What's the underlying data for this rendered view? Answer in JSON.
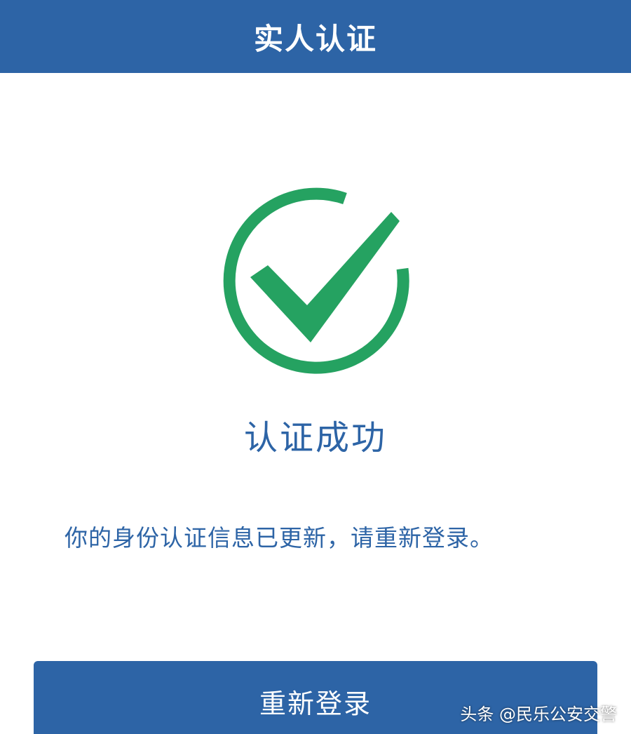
{
  "header": {
    "title": "实人认证"
  },
  "result": {
    "icon": "check-circle-icon",
    "title": "认证成功",
    "message": "你的身份认证信息已更新，请重新登录。"
  },
  "actions": {
    "relogin_label": "重新登录"
  },
  "watermark": {
    "text": "头条 @民乐公安交警"
  },
  "colors": {
    "primary": "#2d64a6",
    "success": "#25a261",
    "background": "#ffffff"
  }
}
